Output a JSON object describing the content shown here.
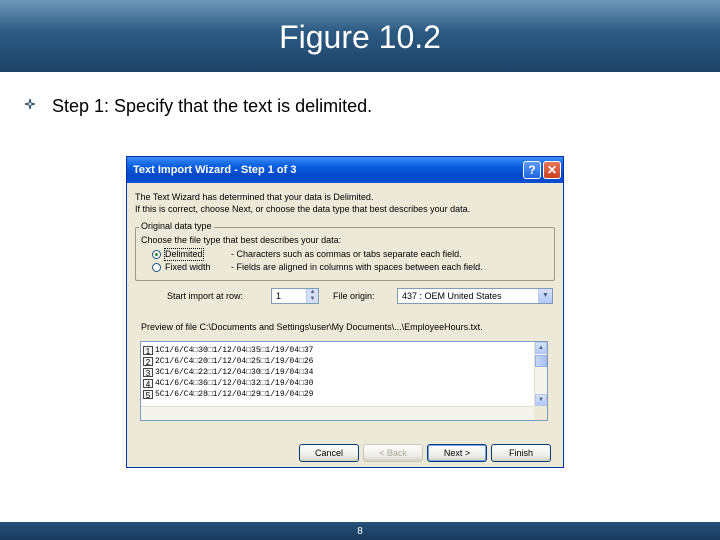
{
  "slide": {
    "title": "Figure 10.2",
    "bullet": "Step 1: Specify that the text is delimited.",
    "page_number": "8"
  },
  "dialog": {
    "title": "Text Import Wizard - Step 1 of 3",
    "help_glyph": "?",
    "close_glyph": "✕",
    "intro_line1": "The Text Wizard has determined that your data is Delimited.",
    "intro_line2": "If this is correct, choose Next, or choose the data type that best describes your data.",
    "group_label": "Original data type",
    "group_prompt": "Choose the file type that best describes your data:",
    "option_delimited": "Delimited",
    "option_delimited_desc": "- Characters such as commas or tabs separate each field.",
    "option_fixed": "Fixed width",
    "option_fixed_desc": "- Fields are aligned in columns with spaces between each field.",
    "start_row_label": "Start import at row:",
    "start_row_value": "1",
    "file_origin_label": "File origin:",
    "file_origin_value": "437 : OEM United States",
    "preview_label": "Preview of file C:\\Documents and Settings\\user\\My Documents\\...\\EmployeeHours.txt.",
    "preview_rows": [
      {
        "num": "1",
        "text": "1C1/6/C4□30□1/12/04□35□1/19/04□37"
      },
      {
        "num": "2",
        "text": "2C1/6/C4□20□1/12/04□25□1/19/04□26"
      },
      {
        "num": "3",
        "text": "3C1/6/C4□22□1/12/04□30□1/19/04□34"
      },
      {
        "num": "4",
        "text": "4C1/6/C4□36□1/12/04□32□1/19/04□30"
      },
      {
        "num": "5",
        "text": "5C1/6/C4□28□1/12/04□29□1/19/04□29"
      }
    ],
    "buttons": {
      "cancel": "Cancel",
      "back": "< Back",
      "next": "Next >",
      "finish": "Finish"
    }
  }
}
